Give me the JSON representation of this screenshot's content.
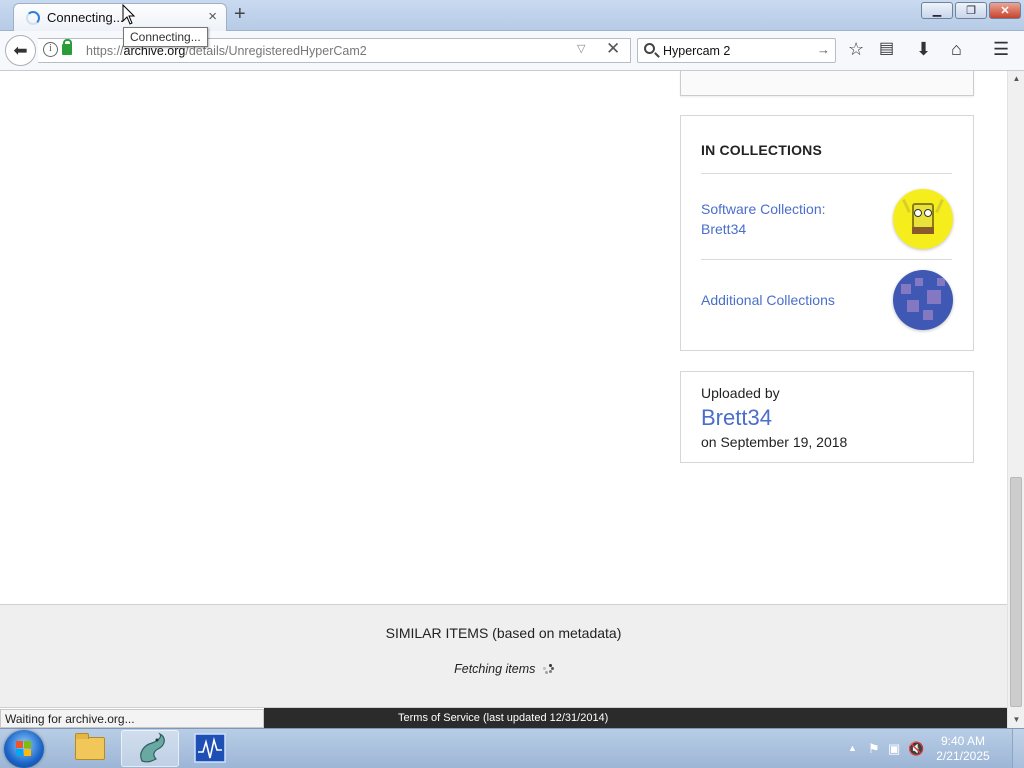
{
  "browser": {
    "tab_title": "Connecting...",
    "tab_close": "×",
    "new_tab": "+",
    "tooltip": "Connecting...",
    "url_prefix": "https://",
    "url_host": "archive.org",
    "url_path": "/details/UnregisteredHyperCam2",
    "search_value": "Hypercam 2",
    "status_text": "Waiting for archive.org..."
  },
  "collections": {
    "heading": "IN COLLECTIONS",
    "items": [
      {
        "line1": "Software Collection:",
        "line2": "Brett34"
      },
      {
        "line1": "Additional Collections"
      }
    ]
  },
  "uploader": {
    "label": "Uploaded by",
    "name": "Brett34",
    "date": "on September 19, 2018"
  },
  "similar": {
    "title": "SIMILAR ITEMS (based on metadata)",
    "fetching": "Fetching items"
  },
  "footer": {
    "text": "Terms of Service (last updated 12/31/2014)"
  },
  "taskbar": {
    "time": "9:40 AM",
    "date": "2/21/2025"
  },
  "icons": [
    "back-icon",
    "info-icon",
    "lock-icon",
    "reader-dropdown-icon",
    "stop-icon",
    "search-icon",
    "search-go-icon",
    "bookmark-star-icon",
    "library-icon",
    "download-icon",
    "home-icon",
    "menu-icon"
  ],
  "colors": {
    "link": "#4a6ec9",
    "footer_bg": "#2b2b2b"
  }
}
